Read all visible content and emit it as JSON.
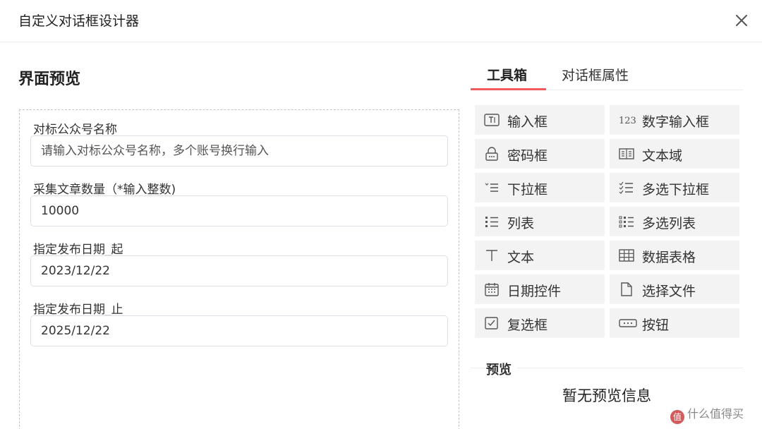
{
  "window": {
    "title": "自定义对话框设计器"
  },
  "section_title": "界面预览",
  "form": {
    "fields": [
      {
        "label": "对标公众号名称",
        "placeholder": "请输入对标公众号名称，多个账号换行输入",
        "value": ""
      },
      {
        "label": "采集文章数量（*输入整数)",
        "placeholder": "",
        "value": "10000"
      },
      {
        "label": "指定发布日期_起",
        "placeholder": "",
        "value": "2023/12/22"
      },
      {
        "label": "指定发布日期_止",
        "placeholder": "",
        "value": "2025/12/22"
      }
    ]
  },
  "tabs": [
    {
      "label": "工具箱",
      "active": true
    },
    {
      "label": "对话框属性",
      "active": false
    }
  ],
  "toolbox": [
    {
      "label": "输入框",
      "icon": "input-box-icon"
    },
    {
      "label": "数字输入框",
      "icon": "number-icon",
      "icon_text": "123"
    },
    {
      "label": "密码框",
      "icon": "lock-icon"
    },
    {
      "label": "文本域",
      "icon": "book-icon"
    },
    {
      "label": "下拉框",
      "icon": "dropdown-list-icon"
    },
    {
      "label": "多选下拉框",
      "icon": "checklist-icon"
    },
    {
      "label": "列表",
      "icon": "list-icon"
    },
    {
      "label": "多选列表",
      "icon": "multi-list-icon"
    },
    {
      "label": "文本",
      "icon": "text-t-icon"
    },
    {
      "label": "数据表格",
      "icon": "table-grid-icon"
    },
    {
      "label": "日期控件",
      "icon": "calendar-icon"
    },
    {
      "label": "选择文件",
      "icon": "file-icon"
    },
    {
      "label": "复选框",
      "icon": "checkbox-icon"
    },
    {
      "label": "按钮",
      "icon": "button-icon"
    }
  ],
  "preview": {
    "title": "预览",
    "empty_text": "暂无预览信息"
  },
  "watermark": {
    "text": "什么值得买",
    "badge": "值"
  }
}
